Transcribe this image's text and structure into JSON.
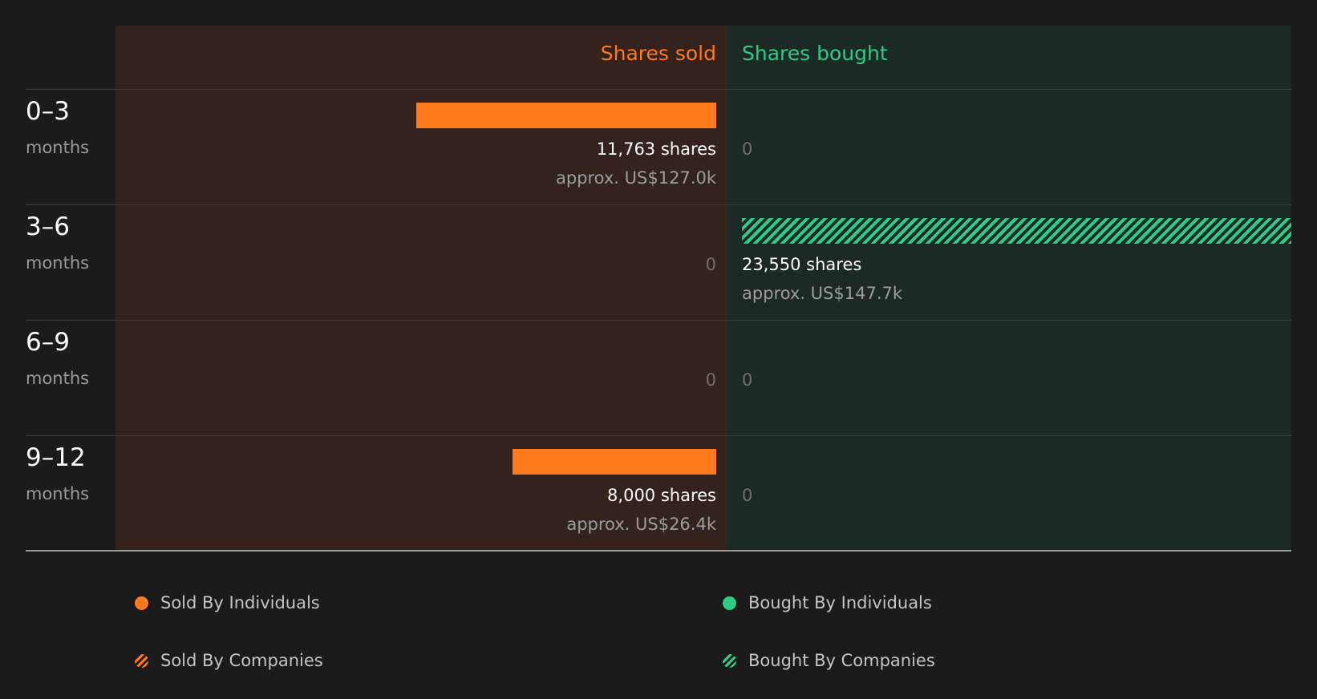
{
  "chart_data": {
    "type": "bar",
    "orientation": "horizontal-diverging",
    "categories": [
      {
        "range": "0–3",
        "unit": "months"
      },
      {
        "range": "3–6",
        "unit": "months"
      },
      {
        "range": "6–9",
        "unit": "months"
      },
      {
        "range": "9–12",
        "unit": "months"
      }
    ],
    "columns": {
      "sold": {
        "title": "Shares sold",
        "color": "#ff7a1a",
        "panel_color": "#33231c"
      },
      "bought": {
        "title": "Shares bought",
        "color": "#2ecc84",
        "panel_color": "#1b2a24"
      }
    },
    "sold": [
      {
        "shares": 11763,
        "shares_label": "11,763 shares",
        "approx": "approx. US$127.0k",
        "by": "individuals"
      },
      {
        "shares": 0,
        "shares_label": "0",
        "approx": "",
        "by": ""
      },
      {
        "shares": 0,
        "shares_label": "0",
        "approx": "",
        "by": ""
      },
      {
        "shares": 8000,
        "shares_label": "8,000 shares",
        "approx": "approx. US$26.4k",
        "by": "individuals"
      }
    ],
    "bought": [
      {
        "shares": 0,
        "shares_label": "0",
        "approx": "",
        "by": ""
      },
      {
        "shares": 23550,
        "shares_label": "23,550 shares",
        "approx": "approx. US$147.7k",
        "by": "companies"
      },
      {
        "shares": 0,
        "shares_label": "0",
        "approx": "",
        "by": ""
      },
      {
        "shares": 0,
        "shares_label": "0",
        "approx": "",
        "by": ""
      }
    ],
    "scale_max": 23550,
    "legend": [
      {
        "label": "Sold By Individuals",
        "color": "#ff7a1a",
        "pattern": "solid",
        "icon": "orange-dot-icon"
      },
      {
        "label": "Bought By Individuals",
        "color": "#2ecc84",
        "pattern": "solid",
        "icon": "green-dot-icon"
      },
      {
        "label": "Sold By Companies",
        "color": "#ff7a1a",
        "pattern": "hatched",
        "icon": "orange-hatched-dot-icon"
      },
      {
        "label": "Bought By Companies",
        "color": "#2ecc84",
        "pattern": "hatched",
        "icon": "green-hatched-dot-icon"
      }
    ]
  }
}
